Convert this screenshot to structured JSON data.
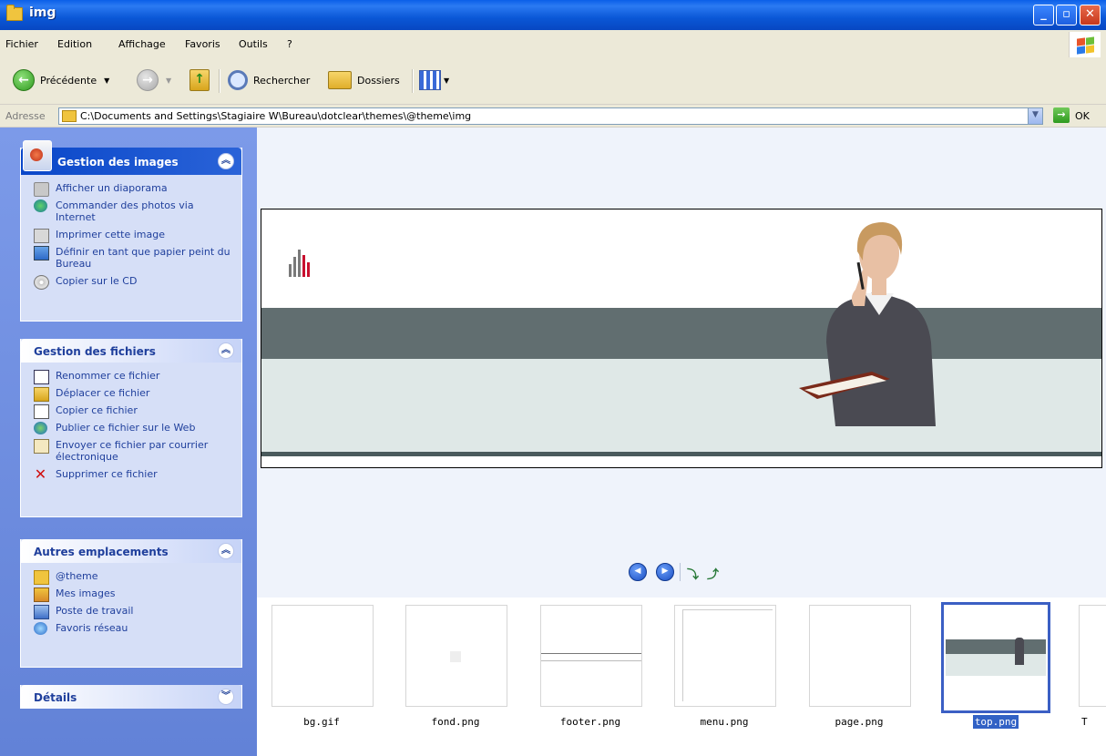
{
  "window": {
    "title": "img",
    "min": "_",
    "max": "▫",
    "close": "✕"
  },
  "menu": {
    "items": [
      "Fichier",
      "Edition",
      "Affichage",
      "Favoris",
      "Outils",
      "?"
    ]
  },
  "toolbar": {
    "back_label": "Précédente",
    "search_label": "Rechercher",
    "folders_label": "Dossiers"
  },
  "address": {
    "label": "Adresse",
    "path": "C:\\Documents and Settings\\Stagiaire W\\Bureau\\dotclear\\themes\\@theme\\img",
    "ok_label": "OK"
  },
  "sidebar": {
    "image_tasks": {
      "title": "Gestion des images",
      "items": [
        "Afficher un diaporama",
        "Commander des photos via Internet",
        "Imprimer cette image",
        "Définir en tant que papier peint du Bureau",
        "Copier sur le CD"
      ]
    },
    "file_tasks": {
      "title": "Gestion des fichiers",
      "items": [
        "Renommer ce fichier",
        "Déplacer ce fichier",
        "Copier ce fichier",
        "Publier ce fichier sur le Web",
        "Envoyer ce fichier par courrier électronique",
        "Supprimer ce fichier"
      ]
    },
    "other_places": {
      "title": "Autres emplacements",
      "items": [
        "@theme",
        "Mes images",
        "Poste de travail",
        "Favoris réseau"
      ]
    },
    "details": {
      "title": "Détails"
    }
  },
  "filmstrip": {
    "files": [
      "bg.gif",
      "fond.png",
      "footer.png",
      "menu.png",
      "page.png",
      "top.png",
      "T"
    ],
    "selected": "top.png"
  }
}
